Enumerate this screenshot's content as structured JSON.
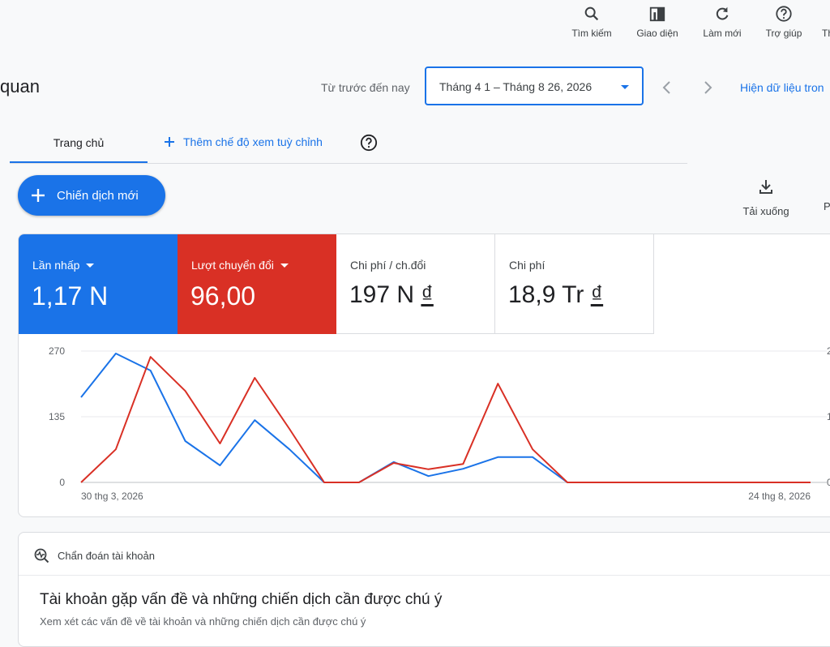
{
  "toolbar": {
    "search": "Tìm kiếm",
    "appearance": "Giao diện",
    "refresh": "Làm mới",
    "help": "Trợ giúp",
    "more_cut": "Th"
  },
  "page": {
    "title": "quan",
    "range_label": "Từ trước đến nay",
    "date_range": "Tháng 4 1 – Tháng 8 26, 2026",
    "show_data": "Hiện dữ liệu tron"
  },
  "tabs": {
    "home": "Trang chủ",
    "add_view": "Thêm chế độ xem tuỳ chỉnh"
  },
  "actions": {
    "new_campaign": "Chiến dịch mới",
    "download": "Tải xuống",
    "edge_cut": "P"
  },
  "metrics": [
    {
      "label": "Lần nhấp",
      "value": "1,17 N",
      "color": "#1a73e8"
    },
    {
      "label": "Lượt chuyển đổi",
      "value": "96,00",
      "color": "#d93025"
    },
    {
      "label": "Chi phí / ch.đổi",
      "value_num": "197 N",
      "value_cur": "₫"
    },
    {
      "label": "Chi phí",
      "value_num": "18,9 Tr",
      "value_cur": "₫"
    }
  ],
  "chart_data": {
    "type": "line",
    "x_start_label": "30 thg 3, 2026",
    "x_end_label": "24 thg 8, 2026",
    "ylim": [
      0,
      270
    ],
    "y_ticks": [
      "270",
      "135",
      "0"
    ],
    "y_right_ticks_cut": [
      "2",
      "1",
      "0"
    ],
    "grid": true,
    "series": [
      {
        "name": "Lần nhấp",
        "color": "#1a73e8",
        "values": [
          175,
          265,
          230,
          85,
          35,
          128,
          68,
          0,
          0,
          42,
          13,
          28,
          52,
          52,
          0,
          0,
          0,
          0,
          0,
          0,
          0,
          0
        ]
      },
      {
        "name": "Lượt chuyển đổi",
        "color": "#d93025",
        "values": [
          0,
          68,
          258,
          188,
          80,
          215,
          110,
          0,
          0,
          40,
          27,
          38,
          203,
          68,
          0,
          0,
          0,
          0,
          0,
          0,
          0,
          0
        ]
      }
    ]
  },
  "diagnosis": {
    "header": "Chẩn đoán tài khoản",
    "title": "Tài khoản gặp vấn đề và những chiến dịch cần được chú ý",
    "subtitle": "Xem xét các vấn đề về tài khoản và những chiến dịch cần được chú ý"
  }
}
